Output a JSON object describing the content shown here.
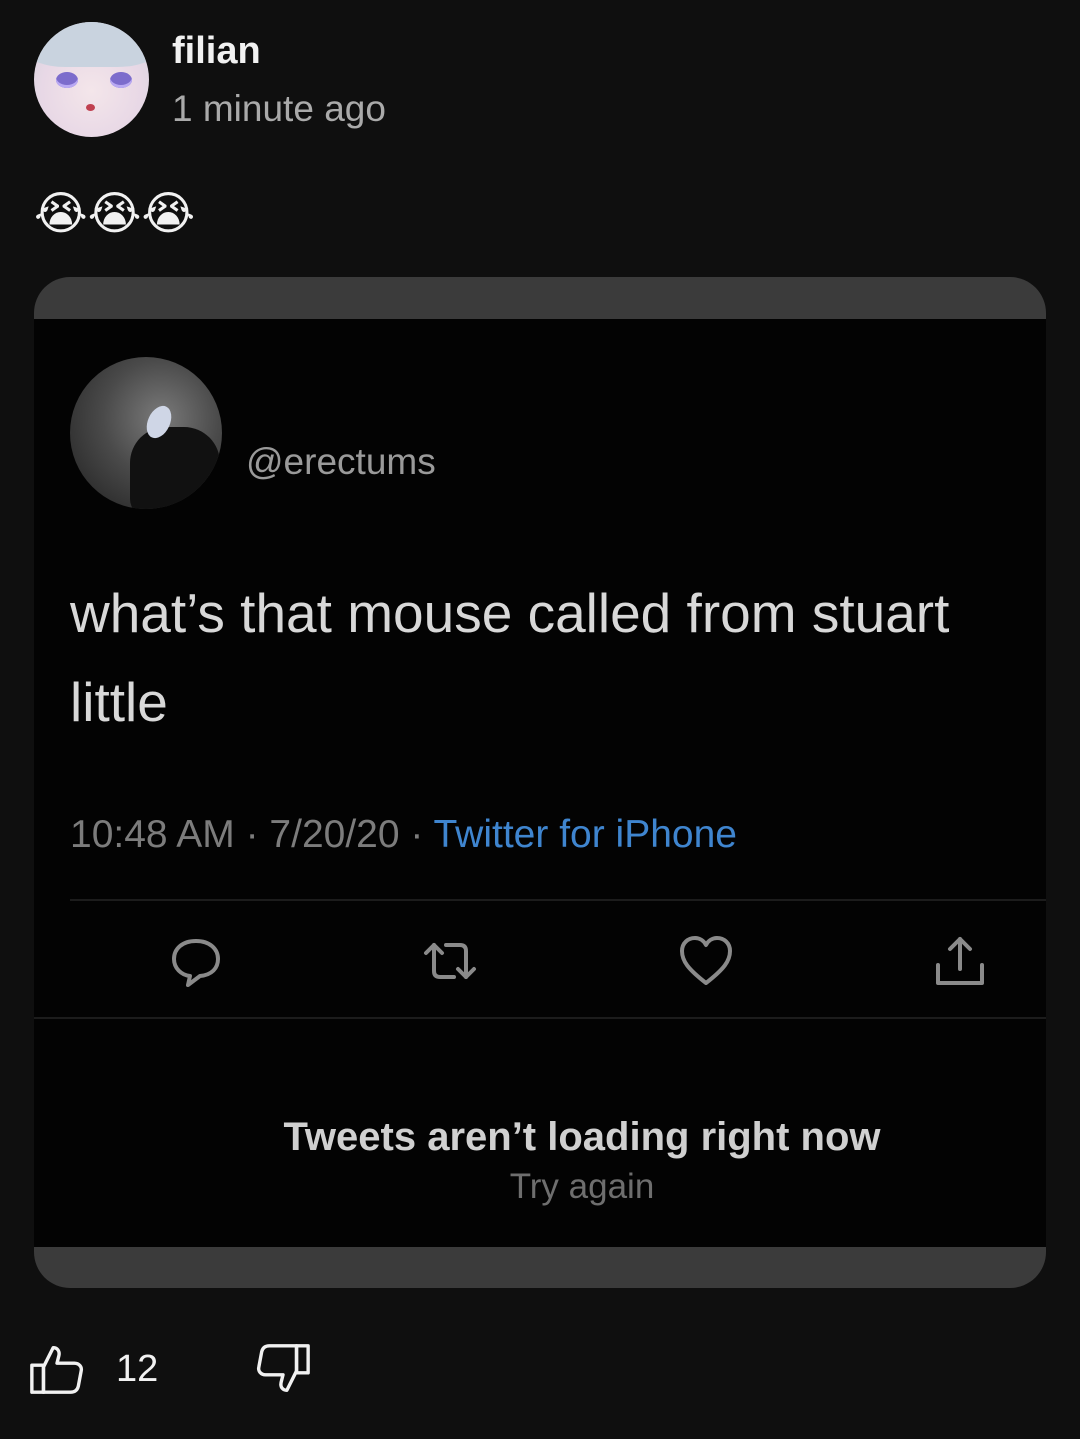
{
  "post": {
    "author": "filian",
    "time": "1 minute ago",
    "text": "😭😭😭"
  },
  "tweet": {
    "handle": "@erectums",
    "body": "what’s that mouse called from stuart little",
    "time_date": "10:48 AM · 7/20/20 · ",
    "source": "Twitter for iPhone",
    "actions": {
      "reply_icon": "reply-icon",
      "retweet_icon": "retweet-icon",
      "like_icon": "heart-icon",
      "share_icon": "share-icon"
    },
    "error_title": "Tweets aren’t loading right now",
    "error_retry": "Try again"
  },
  "votes": {
    "up_count": "12",
    "up_icon": "thumbs-up-icon",
    "down_icon": "thumbs-down-icon"
  },
  "colors": {
    "background": "#0f0f0f",
    "frame": "#3b3b3b",
    "link": "#3f85cf"
  }
}
